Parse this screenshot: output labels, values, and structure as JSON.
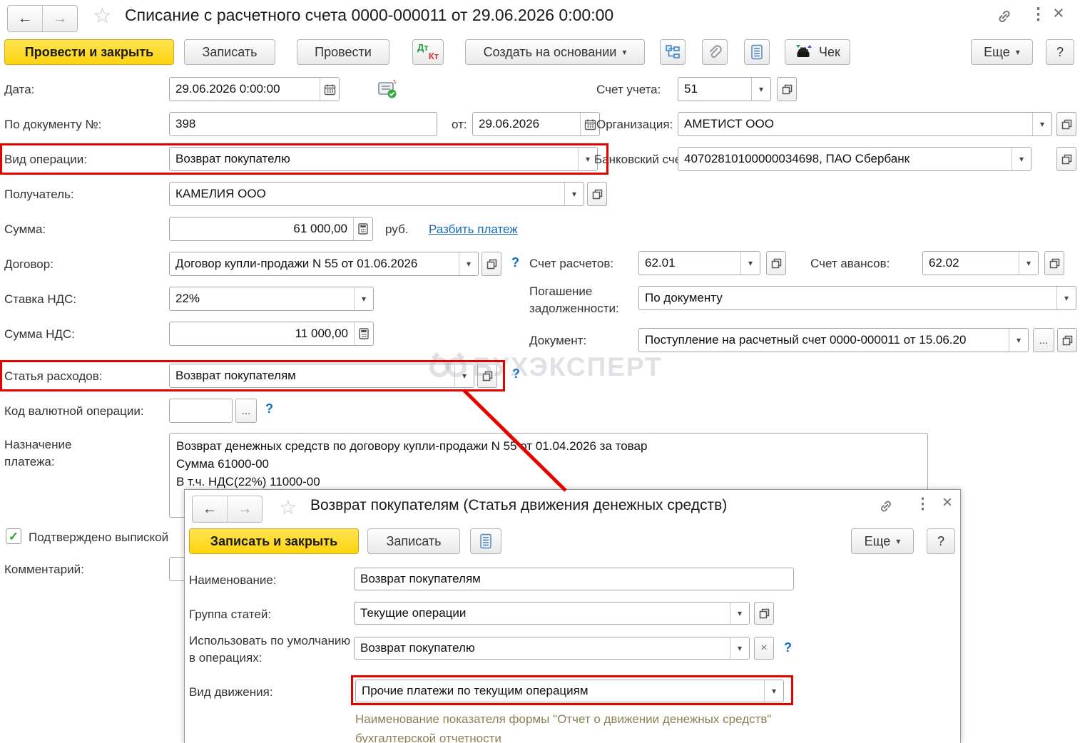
{
  "icons": {
    "back": "←",
    "forward": "→",
    "star": "☆",
    "menu": "⋮",
    "close": "×",
    "dropdown": "▾",
    "ellipsis": "...",
    "check": "✓",
    "clear": "×",
    "question": "?"
  },
  "colors": {
    "accent_yellow": "#fed310",
    "annotation_red": "#e60000",
    "link_blue": "#1566b8",
    "hint_olive": "#8c7f55"
  },
  "watermark": {
    "text": "БУХЭКСПЕРТ"
  },
  "main": {
    "title": "Списание с расчетного счета 0000-000011 от 29.06.2026 0:00:00",
    "toolbar": {
      "post_and_close": "Провести и закрыть",
      "save": "Записать",
      "post": "Провести",
      "dt": "Дт",
      "kt": "Кт",
      "create_based_on": "Создать на основании",
      "receipt": "Чек",
      "more": "Еще",
      "help": "?"
    },
    "fields": {
      "date_label": "Дата:",
      "date_value": "29.06.2026  0:00:00",
      "doc_no_label": "По документу №:",
      "doc_no_value": "398",
      "from_label": "от:",
      "from_value": "29.06.2026",
      "operation_label": "Вид операции:",
      "operation_value": "Возврат покупателю",
      "recipient_label": "Получатель:",
      "recipient_value": "КАМЕЛИЯ ООО",
      "amount_label": "Сумма:",
      "amount_value": "61 000,00",
      "currency": "руб.",
      "split_payment": "Разбить платеж",
      "contract_label": "Договор:",
      "contract_value": "Договор купли-продажи N 55 от 01.06.2026",
      "vat_rate_label": "Ставка НДС:",
      "vat_rate_value": "22%",
      "vat_amount_label": "Сумма НДС:",
      "vat_amount_value": "11 000,00",
      "expense_item_label": "Статья расходов:",
      "expense_item_value": "Возврат покупателям",
      "currency_code_label": "Код валютной операции:",
      "currency_code_value": "",
      "purpose_label": "Назначение платежа:",
      "purpose_value": "Возврат денежных средств по договору купли-продажи N 55 от 01.04.2026 за товар\nСумма 61000-00\nВ т.ч. НДС(22%) 11000-00",
      "account_label": "Счет учета:",
      "account_value": "51",
      "organization_label": "Организация:",
      "organization_value": "АМЕТИСТ ООО",
      "bank_account_label": "Банковский счет:",
      "bank_account_value": "40702810100000034698, ПАО Сбербанк",
      "settlement_label": "Счет расчетов:",
      "settlement_value": "62.01",
      "advances_label": "Счет авансов:",
      "advances_value": "62.02",
      "repayment_label": "Погашение задолженности:",
      "repayment_value": "По документу",
      "document_label": "Документ:",
      "document_value": "Поступление на расчетный счет 0000-000011 от 15.06.20",
      "confirmed_label": "Подтверждено выпиской",
      "comment_label": "Комментарий:"
    }
  },
  "child": {
    "title": "Возврат покупателям (Статья движения денежных средств)",
    "toolbar": {
      "save_and_close": "Записать и закрыть",
      "save": "Записать",
      "more": "Еще",
      "help": "?"
    },
    "fields": {
      "name_label": "Наименование:",
      "name_value": "Возврат покупателям",
      "group_label": "Группа статей:",
      "group_value": "Текущие операции",
      "default_label": "Использовать по умолчанию в операциях:",
      "default_value": "Возврат покупателю",
      "movement_label": "Вид движения:",
      "movement_value": "Прочие платежи по текущим операциям",
      "hint": "Наименование показателя формы \"Отчет о движении денежных средств\" бухгалтерской отчетности"
    }
  }
}
